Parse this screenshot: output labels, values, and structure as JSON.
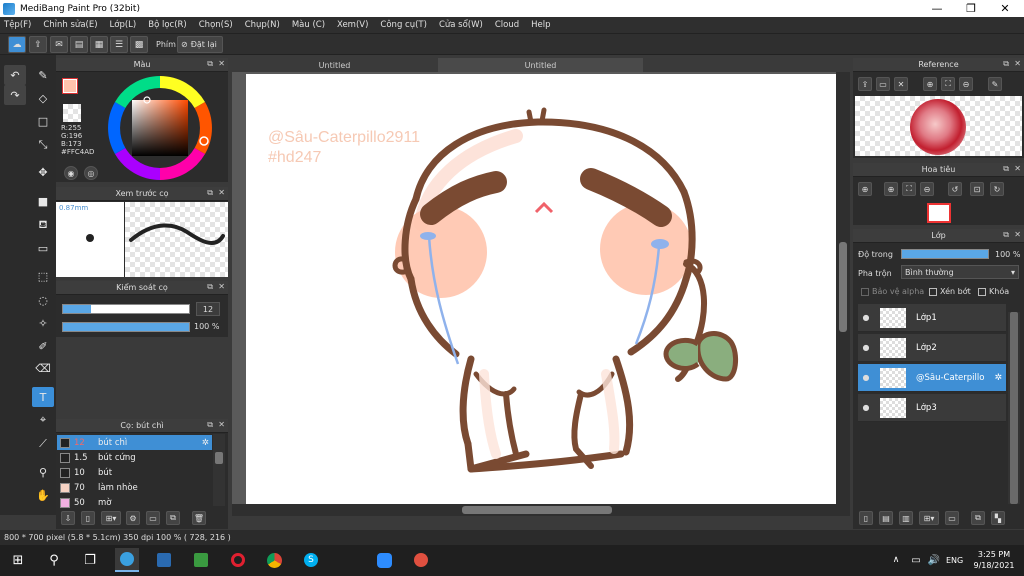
{
  "window": {
    "title": "MediBang Paint Pro (32bit)"
  },
  "menu": [
    "Tệp(F)",
    "Chỉnh sửa(E)",
    "Lớp(L)",
    "Bộ lọc(R)",
    "Chọn(S)",
    "Chụp(N)",
    "Màu (C)",
    "Xem(V)",
    "Công cụ(T)",
    "Cửa sổ(W)",
    "Cloud",
    "Help"
  ],
  "toolbar": {
    "key_label": "Phím",
    "reset_label": "Đặt lại"
  },
  "color_panel": {
    "title": "Màu",
    "r": "R:255",
    "g": "G:196",
    "b": "B:173",
    "hex": "#FFC4AD"
  },
  "brush_preview": {
    "title": "Xem trước cọ",
    "size": "0.87mm"
  },
  "brush_control": {
    "title": "Kiểm soát cọ",
    "size_value": "12",
    "opacity_value": "100 %",
    "opacity_fraction": 1.0
  },
  "brush_list": {
    "title": "Cọ: bút chì",
    "items": [
      {
        "size": "12",
        "name": "bút chì",
        "color": "#222222",
        "selected": true
      },
      {
        "size": "1.5",
        "name": "bút cứng",
        "color": "#222222",
        "selected": false
      },
      {
        "size": "10",
        "name": "bút",
        "color": "#222222",
        "selected": false
      },
      {
        "size": "70",
        "name": "làm nhòe",
        "color": "#f6d3c4",
        "selected": false
      },
      {
        "size": "50",
        "name": "mờ",
        "color": "#f0b0e0",
        "selected": false
      }
    ]
  },
  "tabs": [
    "Untitled",
    "Untitled"
  ],
  "canvas": {
    "watermark_line1": "@Sâu-Caterpillo2911",
    "watermark_line2": "#hd247"
  },
  "reference": {
    "title": "Reference"
  },
  "navigator": {
    "title": "Hoa tiêu"
  },
  "layers_panel": {
    "title": "Lớp",
    "opacity_label": "Độ trong",
    "opacity_value": "100 %",
    "opacity_fraction": 1.0,
    "blend_label": "Pha trộn",
    "blend_value": "Bình thường",
    "protect_alpha": "Bảo vệ alpha",
    "clipping": "Xén bớt",
    "lock": "Khóa",
    "layers": [
      {
        "name": "Lớp1",
        "selected": false
      },
      {
        "name": "Lớp2",
        "selected": false
      },
      {
        "name": "@Sâu-Caterpillo",
        "selected": true
      },
      {
        "name": "Lớp3",
        "selected": false
      }
    ]
  },
  "status": {
    "text": "800 * 700 pixel   (5.8 * 5.1cm)   350 dpi   100 %   ( 728, 216 )"
  },
  "taskbar": {
    "lang": "ENG",
    "time": "3:25 PM",
    "date": "9/18/2021"
  },
  "colors": {
    "accent": "#3f8fd5",
    "stroke": "#7a4a32",
    "blush": "#ffc4ad",
    "leaf": "#8aae7e"
  }
}
